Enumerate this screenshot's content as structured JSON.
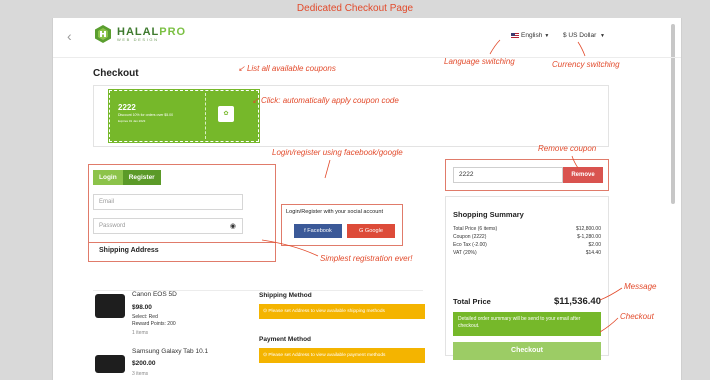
{
  "banner": {
    "title": "Dedicated Checkout Page"
  },
  "header": {
    "back_icon": "chevron-left-icon",
    "logo_main_a": "HALAL",
    "logo_main_b": "PRO",
    "logo_sub": "WEB DESIGN",
    "language": "English",
    "currency": "$ US Dollar"
  },
  "page": {
    "title": "Checkout"
  },
  "annotations": {
    "coupons": "List all available coupons",
    "language": "Language switching",
    "currency": "Currency switching",
    "click_apply": "Click: automatically apply coupon code",
    "login_social": "Login/register using facebook/google",
    "remove_coupon": "Remove coupon",
    "simplest_reg": "Simplest registration ever!",
    "message": "Message",
    "checkout": "Checkout"
  },
  "coupon": {
    "code": "2222",
    "description": "Discount 10% for orders over $5.00",
    "expires": "Expires 01 Jan 2023",
    "apply_icon": "checkmark-icon"
  },
  "login": {
    "tab_login": "Login",
    "tab_register": "Register",
    "email_placeholder": "Email",
    "password_placeholder": "Password",
    "shipping_address": "Shipping Address"
  },
  "social": {
    "label": "Login/Register with your social account",
    "facebook": "f  Facebook",
    "google": "G  Google"
  },
  "products": [
    {
      "name": "Canon EOS 5D",
      "price": "$98.00",
      "select": "Select: Red",
      "points": "Reward Points: 200",
      "items": "1 items"
    },
    {
      "name": "Samsung Galaxy Tab 10.1",
      "price": "$200.00",
      "items": "3 items"
    }
  ],
  "shipping_method": {
    "title": "Shipping Method",
    "warning": "Please set Address to view available shipping methods"
  },
  "payment_method": {
    "title": "Payment Method",
    "warning": "Please set Address to view available payment methods"
  },
  "coupon_apply": {
    "value": "2222",
    "remove": "Remove"
  },
  "summary": {
    "title": "Shopping Summary",
    "rows": [
      {
        "label": "Total Price (6 items)",
        "value": "$12,800.00"
      },
      {
        "label": "Coupon (2222)",
        "value": "$-1,280.00"
      },
      {
        "label": "Eco Tax (-2.00)",
        "value": "$2.00"
      },
      {
        "label": "VAT (20%)",
        "value": "$14.40"
      }
    ],
    "total_label": "Total Price",
    "total_value": "$11,536.40",
    "message": "Detailed order summary will be send to your email after checkout.",
    "checkout": "Checkout"
  }
}
